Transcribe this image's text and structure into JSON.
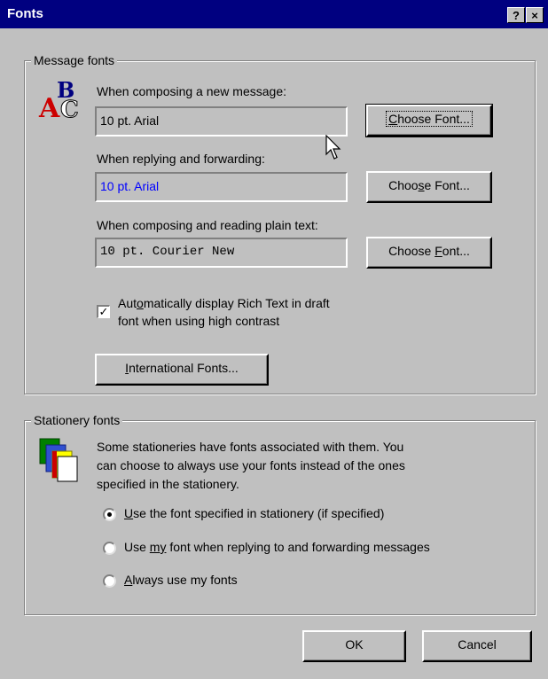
{
  "window": {
    "title": "Fonts",
    "help_button": "?",
    "close_button": "×"
  },
  "message_fonts": {
    "legend": "Message fonts",
    "compose_label": "When composing a new message:",
    "compose_value": "10 pt. Arial",
    "reply_label": "When replying and forwarding:",
    "reply_value": "10 pt. Arial",
    "plain_label": "When composing and reading plain text:",
    "plain_value": "10 pt. Courier New",
    "choose_font_1": {
      "pre": "",
      "key": "C",
      "post": "hoose Font..."
    },
    "choose_font_2": {
      "pre": "Choo",
      "key": "s",
      "post": "e Font..."
    },
    "choose_font_3": {
      "pre": "Choose ",
      "key": "F",
      "post": "ont..."
    },
    "rich_text_line1": {
      "pre": "Aut",
      "key": "o",
      "post": "matically display Rich Text in draft"
    },
    "rich_text_line2": "font when using high contrast",
    "rich_text_checked": true,
    "intl_button": {
      "pre": "",
      "key": "I",
      "post": "nternational Fonts..."
    }
  },
  "stationery_fonts": {
    "legend": "Stationery fonts",
    "description_lines": [
      "Some stationeries have fonts associated with them. You",
      "can choose to always use your fonts instead of the ones",
      "specified in the stationery."
    ],
    "option1": {
      "pre": "",
      "key": "U",
      "post": "se the font specified in stationery (if specified)"
    },
    "option2": {
      "pre": "Use ",
      "key": "my",
      "post": " font when replying to and forwarding messages"
    },
    "option3": {
      "pre": "",
      "key": "A",
      "post": "lways use my fonts"
    },
    "selected_option": 1
  },
  "footer": {
    "ok_label": "OK",
    "cancel_label": "Cancel"
  },
  "icons": {
    "abc": "abc-fonts-icon",
    "stationery": "stationery-icon",
    "cursor": "mouse-pointer-icon"
  }
}
